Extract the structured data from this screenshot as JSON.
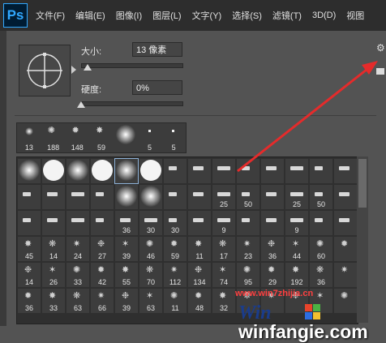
{
  "app": {
    "logo": "Ps"
  },
  "menu": [
    "文件(F)",
    "编辑(E)",
    "图像(I)",
    "图层(L)",
    "文字(Y)",
    "选择(S)",
    "滤镜(T)",
    "3D(D)",
    "视图"
  ],
  "brush": {
    "size_label": "大小:",
    "size_value": "13 像素",
    "hardness_label": "硬度:",
    "hardness_value": "0%"
  },
  "recent_brushes": [
    "13",
    "188",
    "148",
    "59",
    "",
    "5",
    "5"
  ],
  "grid_rows": [
    [
      "",
      "",
      "",
      "",
      "",
      "",
      "",
      "",
      "",
      "",
      "",
      "",
      "",
      ""
    ],
    [
      "",
      "",
      "",
      "",
      "",
      "",
      "",
      "",
      "25",
      "50",
      "",
      "25",
      "50",
      ""
    ],
    [
      "",
      "",
      "",
      "",
      "36",
      "30",
      "30",
      "",
      "9",
      "",
      "",
      "9",
      "",
      ""
    ],
    [
      "45",
      "14",
      "24",
      "27",
      "39",
      "46",
      "59",
      "11",
      "17",
      "23",
      "36",
      "44",
      "60",
      ""
    ],
    [
      "14",
      "26",
      "33",
      "42",
      "55",
      "70",
      "112",
      "134",
      "74",
      "95",
      "29",
      "192",
      "36",
      ""
    ],
    [
      "36",
      "33",
      "63",
      "66",
      "39",
      "63",
      "11",
      "48",
      "32",
      "",
      "",
      "",
      "",
      ""
    ]
  ],
  "watermark": {
    "site_small": "www.win7zhijia.cn",
    "site_large": "winfangie.com"
  },
  "colors": {
    "accent_arrow": "#e52b2b",
    "ps_blue": "#31a8ff"
  }
}
